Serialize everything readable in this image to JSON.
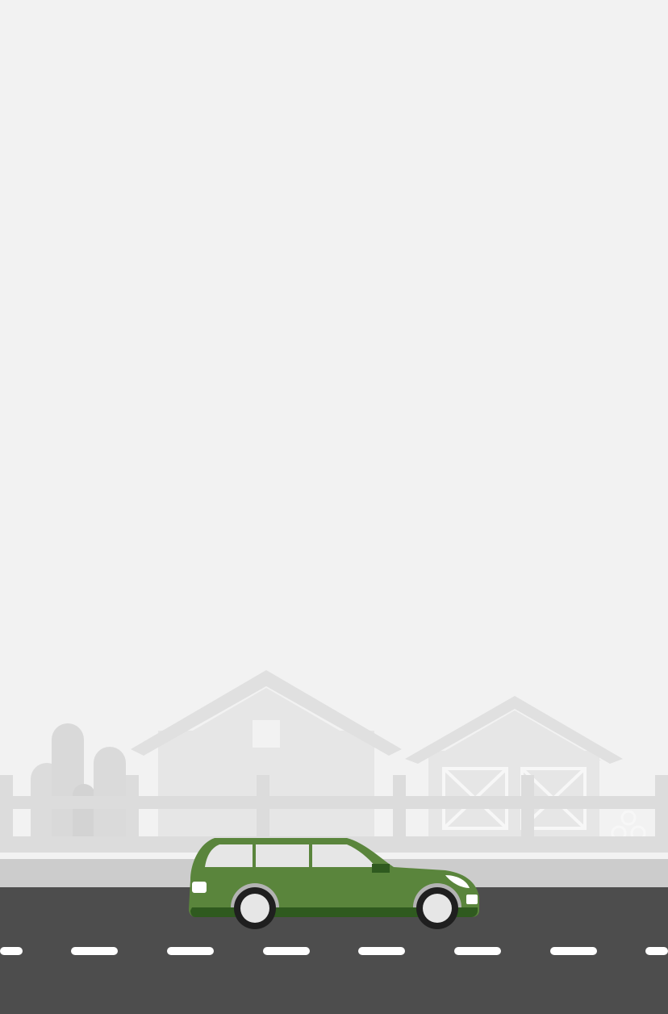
{
  "scene": {
    "description_free": true,
    "colors": {
      "sky": "#f2f2f2",
      "background_buildings": "#e6e6e6",
      "building_trim": "#dadada",
      "silos": "#dcdcdc",
      "fence": "#dcdcdc",
      "sidewalk": "#cccccc",
      "road": "#4d4d4d",
      "lane_marking": "#ffffff",
      "car_body": "#5a853c",
      "car_body_dark": "#2f5a1f",
      "car_window": "#e6e6e6",
      "tire": "#1f1f1f",
      "hubcap": "#e6e6e6",
      "headlight": "#ffffff"
    },
    "icons": {
      "vehicle": "station-wagon-car-icon",
      "farm_house": "house-icon",
      "barn": "barn-icon",
      "silos": "silo-icon",
      "hay_bales": "hay-bale-icon"
    }
  }
}
